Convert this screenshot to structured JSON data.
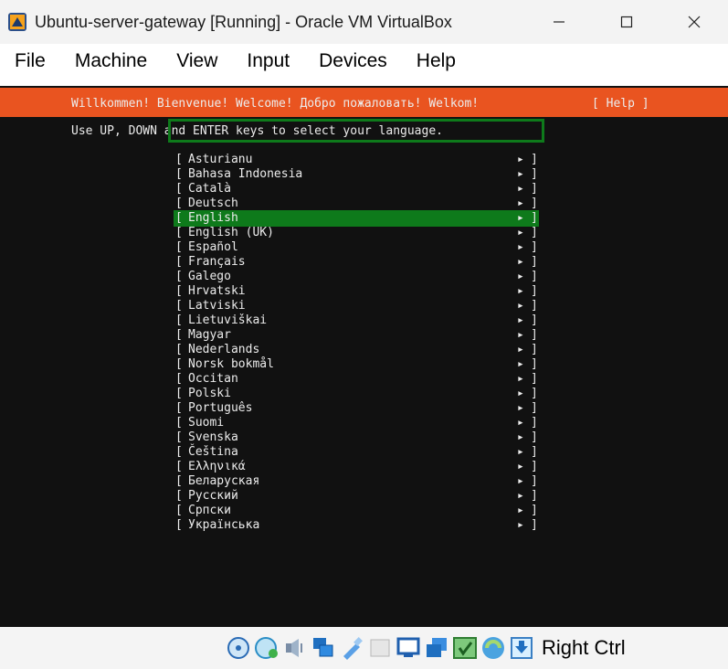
{
  "window": {
    "title": "Ubuntu-server-gateway [Running] - Oracle VM VirtualBox"
  },
  "menu": [
    "File",
    "Machine",
    "View",
    "Input",
    "Devices",
    "Help"
  ],
  "installer": {
    "header": "Willkommen! Bienvenue! Welcome! Добро пожаловать! Welkom!",
    "help": "[ Help ]",
    "instructions": "Use UP, DOWN and ENTER keys to select your language.",
    "bracket_left": "[",
    "bracket_right": "]",
    "arrow": "▸",
    "languages": [
      "Asturianu",
      "Bahasa Indonesia",
      "Català",
      "Deutsch",
      "English",
      "English (UK)",
      "Español",
      "Français",
      "Galego",
      "Hrvatski",
      "Latviski",
      "Lietuviškai",
      "Magyar",
      "Nederlands",
      "Norsk bokmål",
      "Occitan",
      "Polski",
      "Português",
      "Suomi",
      "Svenska",
      "Čeština",
      "Ελληνικά",
      "Беларуская",
      "Русский",
      "Српски",
      "Українська"
    ],
    "selected_language": "English"
  },
  "statusbar": {
    "icons": [
      "hard-disk-icon",
      "optical-drive-icon",
      "audio-icon",
      "network-icon",
      "usb-icon",
      "shared-folders-icon",
      "display-icon",
      "video-capture-icon",
      "recording-icon",
      "cpu-activity-icon",
      "host-key-arrow-icon"
    ],
    "host_key": "Right Ctrl"
  },
  "colors": {
    "ubuntu_orange": "#e95420",
    "selection_green": "#0e7a1b",
    "console_bg": "#111111"
  }
}
